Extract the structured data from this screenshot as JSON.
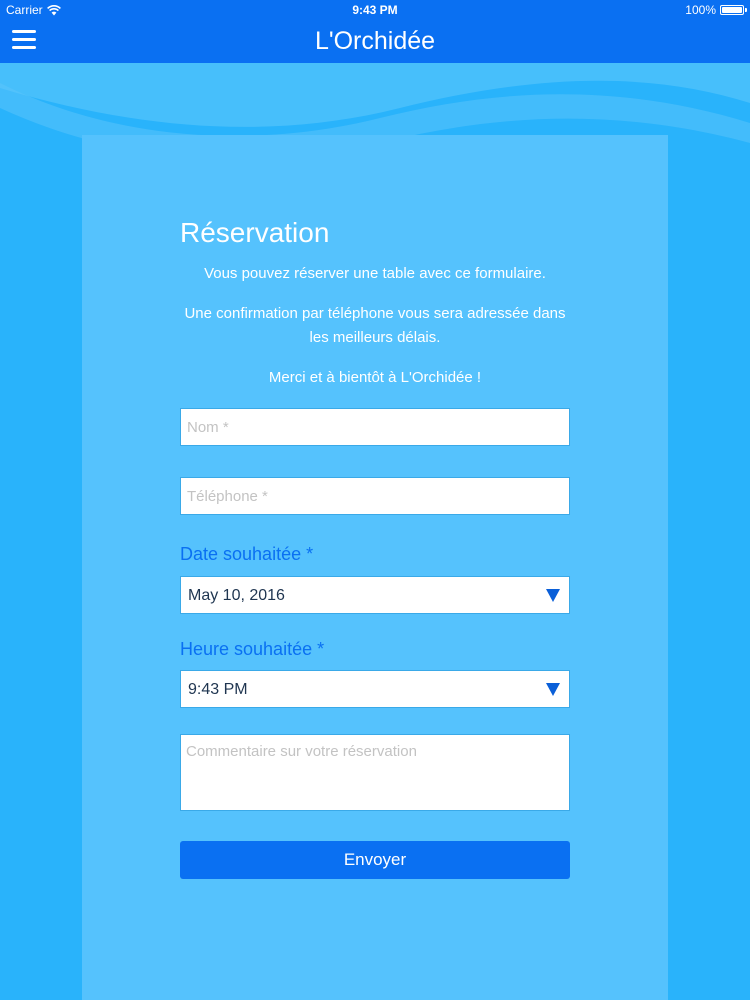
{
  "status_bar": {
    "carrier": "Carrier",
    "time": "9:43 PM",
    "battery": "100%",
    "battery_level": 1.0
  },
  "nav": {
    "title": "L'Orchidée",
    "menu_icon": "hamburger-menu-icon"
  },
  "form": {
    "title": "Réservation",
    "intro": "Vous pouvez réserver une table avec ce formulaire.",
    "confirmation": "Une confirmation par téléphone vous sera adressée dans les meilleurs délais.",
    "thanks": "Merci et à bientôt à L'Orchidée !",
    "name_placeholder": "Nom *",
    "phone_placeholder": "Téléphone *",
    "date_label": "Date souhaitée *",
    "date_value": "May 10, 2016",
    "time_label": "Heure souhaitée *",
    "time_value": "9:43 PM",
    "comment_placeholder": "Commentaire sur votre réservation",
    "submit_label": "Envoyer"
  },
  "colors": {
    "nav_background": "#0a70f2",
    "page_background": "#29b3fb",
    "panel_background": "#55c2fd",
    "accent": "#0a70f2"
  }
}
